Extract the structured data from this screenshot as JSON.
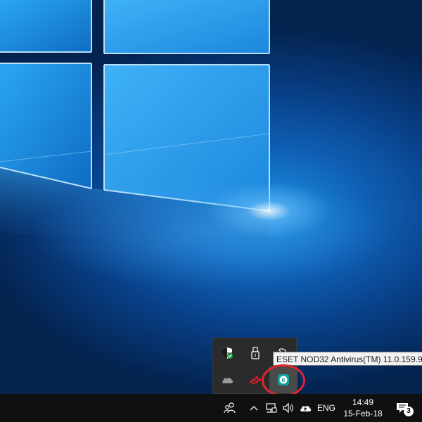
{
  "desktop": {
    "background_colors": {
      "deep": "#04234f",
      "mid": "#0f5fb4",
      "bright": "#1c8fe2"
    }
  },
  "tray_popup": {
    "icons": [
      {
        "name": "windows-defender-shield-icon"
      },
      {
        "name": "usb-safely-remove-icon"
      },
      {
        "name": "pen-workspace-icon"
      },
      {
        "name": "onedrive-cloud-icon"
      },
      {
        "name": "red-app-dots-icon"
      },
      {
        "name": "eset-nod32-icon"
      }
    ],
    "tooltip": "ESET NOD32 Antivirus(TM) 11.0.159.9",
    "highlight_color": "#e3242b"
  },
  "taskbar": {
    "language": "ENG",
    "time": "14:49",
    "date": "15-Feb-18",
    "notification_count": "3",
    "icons": [
      "people-icon",
      "show-hidden-icons-chevron-icon",
      "network-icon",
      "volume-icon",
      "onedrive-icon",
      "action-center-icon"
    ]
  }
}
